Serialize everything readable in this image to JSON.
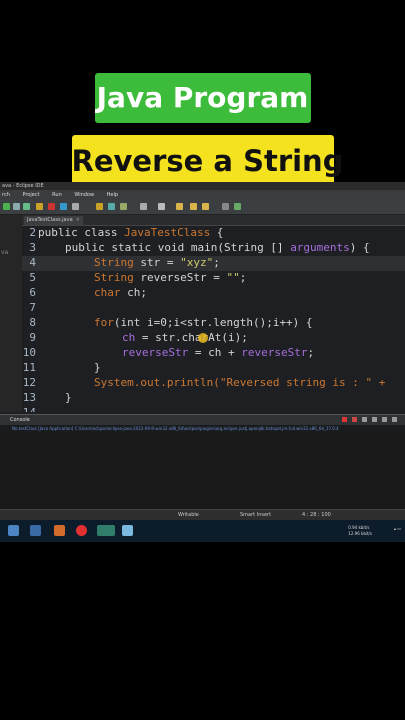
{
  "titles": {
    "line1": "Java Program",
    "line2": "Reverse a String"
  },
  "window": {
    "title": "ava - Eclipse IDE"
  },
  "menu": [
    "rch",
    "Project",
    "Run",
    "Window",
    "Help"
  ],
  "editor_tab": {
    "label": "JavaTestClass.java",
    "close": "×"
  },
  "left_panel": {
    "label": "va"
  },
  "code": {
    "line_numbers": [
      "2",
      "3",
      "4",
      "5",
      "6",
      "7",
      "8",
      "9",
      "10",
      "11",
      "12",
      "13",
      "14"
    ],
    "line2": {
      "kw": "public class ",
      "cls": "JavaTestClass",
      "rest": " {"
    },
    "line3": {
      "kw": "public static void ",
      "name": "main(String [] ",
      "arg": "arguments",
      "rest": ") {"
    },
    "line4": {
      "type": "String ",
      "name": "str = ",
      "str": "\"xyz\"",
      "rest": ";"
    },
    "line5": {
      "type": "String ",
      "name": "reverseStr = ",
      "str": "\"\"",
      "rest": ";"
    },
    "line6": {
      "type": "char ",
      "name": "ch;"
    },
    "line8": {
      "kw": "for",
      "rest": "(int i=0;i<str.length();i++) {"
    },
    "line9": {
      "var": "ch",
      "rest": " = str.charAt(i);"
    },
    "line10": {
      "var": "reverseStr",
      "mid": " = ch + ",
      "var2": "reverseStr",
      "rest": ";"
    },
    "line11": {
      "rest": "}"
    },
    "line12": {
      "sys": "System",
      "mid": ".out.println(",
      "str": "\"Reversed string is : \"",
      "rest": " +"
    },
    "line13": {
      "rest": "}"
    }
  },
  "console": {
    "tab": "Console",
    "terminated_line": "No.testClass [Java Application] C:\\Users\\eclipse\\eclipse-java-2022-09-R-win32-x86_64\\eclipse\\plugins\\org.eclipse.justj.openjdk.hotspot.jre.full.win32.x86_64_17.0.4"
  },
  "status": {
    "writable": "Writable",
    "insert_mode": "Smart Insert",
    "position": "4 : 28 : 100"
  },
  "taskbar": {
    "net_up": "0.94 kbit/s",
    "net_down": "12.96 kbit/s"
  },
  "colors": {
    "title1_bg": "#3dbb3b",
    "title2_bg": "#f3e21d",
    "keyword": "#cc7832",
    "class_name": "#a46edc",
    "string": "#d0cd6b"
  }
}
